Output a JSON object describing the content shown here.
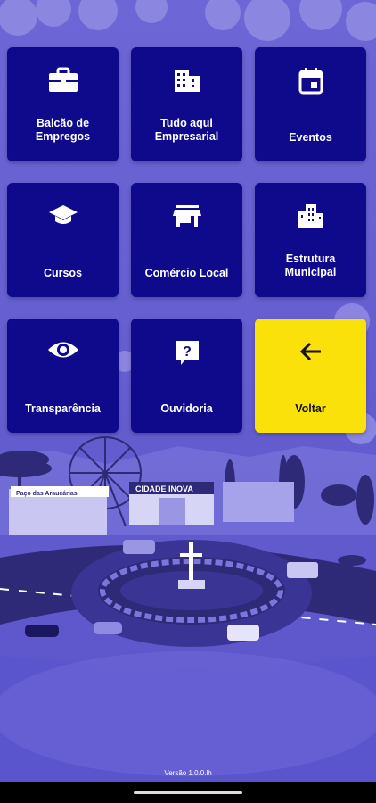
{
  "tiles": [
    {
      "label": "Balcão de\nEmpregos",
      "icon": "briefcase-icon"
    },
    {
      "label": "Tudo aqui\nEmpresarial",
      "icon": "building-icon"
    },
    {
      "label": "Eventos",
      "icon": "calendar-icon"
    },
    {
      "label": "Cursos",
      "icon": "graduation-cap-icon"
    },
    {
      "label": "Comércio Local",
      "icon": "store-icon"
    },
    {
      "label": "Estrutura\nMunicipal",
      "icon": "city-buildings-icon"
    },
    {
      "label": "Transparência",
      "icon": "eye-icon"
    },
    {
      "label": "Ouvidoria",
      "icon": "question-chat-icon"
    },
    {
      "label": "Voltar",
      "icon": "arrow-left-icon"
    }
  ],
  "scene": {
    "sign_left": "Paço das Araucárias",
    "sign_center": "CIDADE INOVA"
  },
  "footer": {
    "version": "Versão 1.0.0.lh"
  },
  "colors": {
    "tile": "#0f0a8c",
    "back_tile": "#fbe10a",
    "background": "#5a54c9",
    "scene_dark": "#2e2a78"
  }
}
